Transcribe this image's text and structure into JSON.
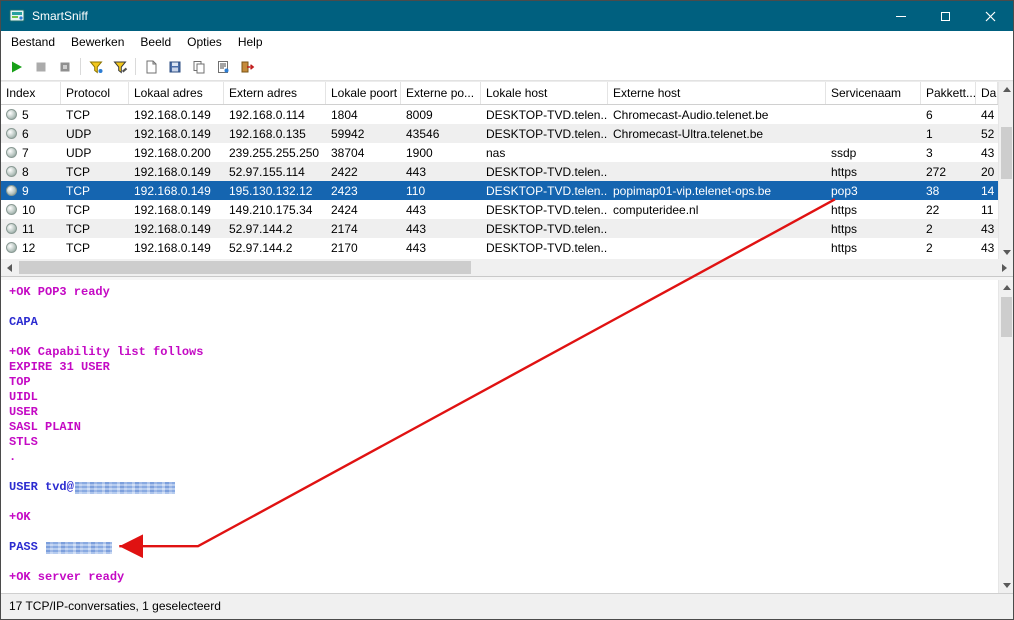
{
  "window": {
    "title": "SmartSniff"
  },
  "menu": {
    "items": [
      "Bestand",
      "Bewerken",
      "Beeld",
      "Opties",
      "Help"
    ]
  },
  "toolbar": {
    "buttons": [
      "start-capture",
      "stop-capture",
      "pause-capture",
      "capture-filter",
      "display-filter",
      "clear-packets",
      "save",
      "copy",
      "properties",
      "exit"
    ]
  },
  "table": {
    "columns": [
      "Index",
      "Protocol",
      "Lokaal adres",
      "Extern adres",
      "Lokale poort",
      "Externe po...",
      "Lokale host",
      "Externe host",
      "Servicenaam",
      "Pakkett...",
      "Da"
    ],
    "rows": [
      {
        "index": "5",
        "protocol": "TCP",
        "local_addr": "192.168.0.149",
        "remote_addr": "192.168.0.114",
        "local_port": "1804",
        "remote_port": "8009",
        "local_host": "DESKTOP-TVD.telen...",
        "remote_host": "Chromecast-Audio.telenet.be",
        "service": "",
        "packets": "6",
        "data": "44",
        "selected": false,
        "shade": false
      },
      {
        "index": "6",
        "protocol": "UDP",
        "local_addr": "192.168.0.149",
        "remote_addr": "192.168.0.135",
        "local_port": "59942",
        "remote_port": "43546",
        "local_host": "DESKTOP-TVD.telen...",
        "remote_host": "Chromecast-Ultra.telenet.be",
        "service": "",
        "packets": "1",
        "data": "52",
        "selected": false,
        "shade": true
      },
      {
        "index": "7",
        "protocol": "UDP",
        "local_addr": "192.168.0.200",
        "remote_addr": "239.255.255.250",
        "local_port": "38704",
        "remote_port": "1900",
        "local_host": "nas",
        "remote_host": "",
        "service": "ssdp",
        "packets": "3",
        "data": "43",
        "selected": false,
        "shade": false
      },
      {
        "index": "8",
        "protocol": "TCP",
        "local_addr": "192.168.0.149",
        "remote_addr": "52.97.155.114",
        "local_port": "2422",
        "remote_port": "443",
        "local_host": "DESKTOP-TVD.telen...",
        "remote_host": "",
        "service": "https",
        "packets": "272",
        "data": "20",
        "selected": false,
        "shade": true
      },
      {
        "index": "9",
        "protocol": "TCP",
        "local_addr": "192.168.0.149",
        "remote_addr": "195.130.132.12",
        "local_port": "2423",
        "remote_port": "110",
        "local_host": "DESKTOP-TVD.telen...",
        "remote_host": "popimap01-vip.telenet-ops.be",
        "service": "pop3",
        "packets": "38",
        "data": "14",
        "selected": true,
        "shade": false
      },
      {
        "index": "10",
        "protocol": "TCP",
        "local_addr": "192.168.0.149",
        "remote_addr": "149.210.175.34",
        "local_port": "2424",
        "remote_port": "443",
        "local_host": "DESKTOP-TVD.telen...",
        "remote_host": "computeridee.nl",
        "service": "https",
        "packets": "22",
        "data": "11",
        "selected": false,
        "shade": false
      },
      {
        "index": "11",
        "protocol": "TCP",
        "local_addr": "192.168.0.149",
        "remote_addr": "52.97.144.2",
        "local_port": "2174",
        "remote_port": "443",
        "local_host": "DESKTOP-TVD.telen...",
        "remote_host": "",
        "service": "https",
        "packets": "2",
        "data": "43",
        "selected": false,
        "shade": true
      },
      {
        "index": "12",
        "protocol": "TCP",
        "local_addr": "192.168.0.149",
        "remote_addr": "52.97.144.2",
        "local_port": "2170",
        "remote_port": "443",
        "local_host": "DESKTOP-TVD.telen...",
        "remote_host": "",
        "service": "https",
        "packets": "2",
        "data": "43",
        "selected": false,
        "shade": false
      }
    ]
  },
  "session": {
    "lines": [
      {
        "text": "+OK POP3 ready",
        "side": "server"
      },
      {
        "text": "",
        "side": "server"
      },
      {
        "text": "CAPA",
        "side": "client"
      },
      {
        "text": "",
        "side": "client"
      },
      {
        "text": "+OK Capability list follows",
        "side": "server"
      },
      {
        "text": "EXPIRE 31 USER",
        "side": "server"
      },
      {
        "text": "TOP",
        "side": "server"
      },
      {
        "text": "UIDL",
        "side": "server"
      },
      {
        "text": "USER",
        "side": "server"
      },
      {
        "text": "SASL PLAIN",
        "side": "server"
      },
      {
        "text": "STLS",
        "side": "server"
      },
      {
        "text": ".",
        "side": "server"
      },
      {
        "text": "",
        "side": "server"
      },
      {
        "text": "USER tvd@",
        "side": "client",
        "redacted": "username"
      },
      {
        "text": "",
        "side": "client"
      },
      {
        "text": "+OK",
        "side": "server"
      },
      {
        "text": "",
        "side": "server"
      },
      {
        "text": "PASS ",
        "side": "client",
        "redacted": "password"
      },
      {
        "text": "",
        "side": "server"
      },
      {
        "text": "+OK server ready",
        "side": "server"
      }
    ]
  },
  "statusbar": {
    "text": "17 TCP/IP-conversaties, 1 geselecteerd"
  },
  "colors": {
    "titlebar": "#00607F",
    "selection": "#1565B0",
    "server": "#C409C4",
    "client": "#2B2BD0",
    "arrow": "#E01212",
    "shade": "#EFEFEF"
  }
}
